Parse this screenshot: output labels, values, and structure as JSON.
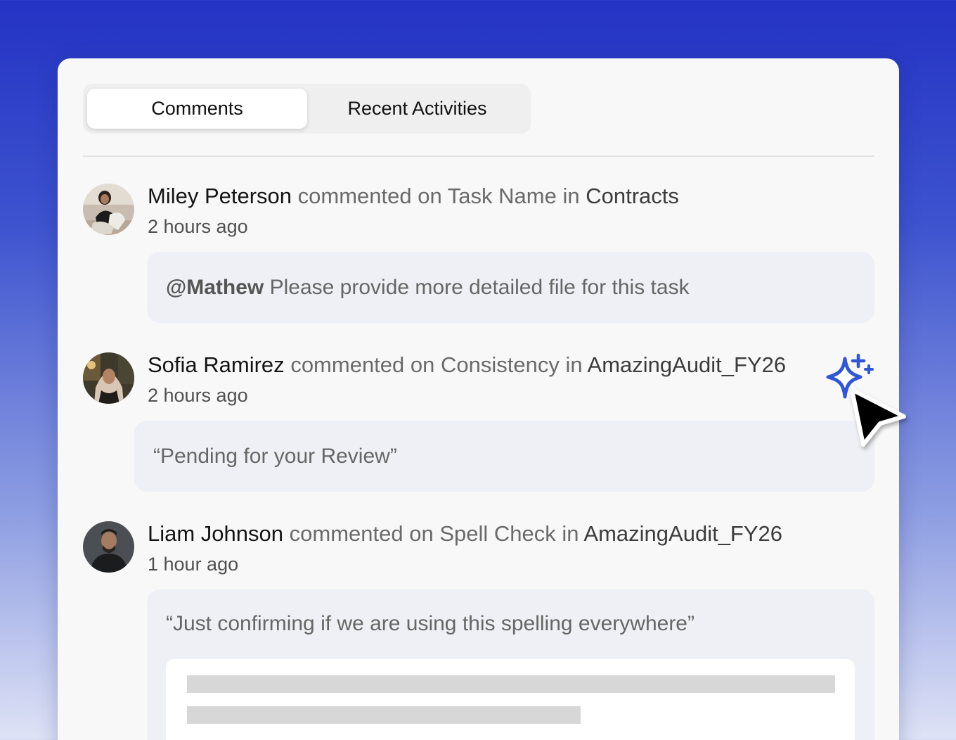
{
  "tabs": [
    {
      "label": "Comments",
      "active": true
    },
    {
      "label": "Recent Activities",
      "active": false
    }
  ],
  "comments": [
    {
      "author": "Miley Peterson",
      "verb": "commented on",
      "item": "Task Name",
      "prep": "in",
      "location": "Contracts",
      "time": "2 hours ago",
      "mention": "@Mathew",
      "body": "Please provide more detailed file for this task"
    },
    {
      "author": "Sofia Ramirez",
      "verb": "commented on",
      "item": "Consistency",
      "prep": "in",
      "location": "AmazingAudit_FY26",
      "time": "2 hours ago",
      "body": "“Pending for your Review”"
    },
    {
      "author": "Liam Johnson",
      "verb": "commented on",
      "item": "Spell Check",
      "prep": "in",
      "location": "AmazingAudit_FY26",
      "time": "1 hour ago",
      "body": "“Just confirming if we are using this spelling everywhere”"
    }
  ],
  "colors": {
    "accent_sparkle": "#2f56d6",
    "background_top": "#2433c4",
    "card": "#f8f8f8",
    "bubble": "#eef0f5"
  },
  "icons": [
    "sparkle-ai-icon",
    "cursor-pointer-icon"
  ]
}
